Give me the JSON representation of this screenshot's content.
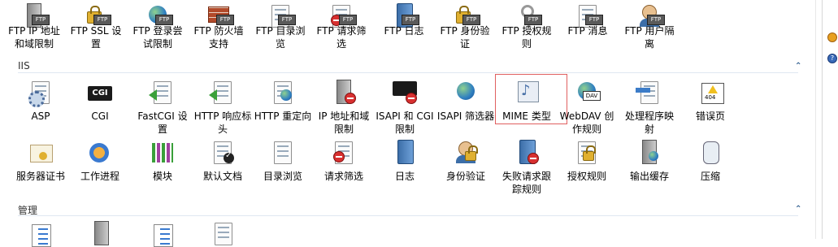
{
  "ftp_row": [
    "FTP IP 地址\n和域限制",
    "FTP SSL 设\n置",
    "FTP 登录尝\n试限制",
    "FTP 防火墙\n支持",
    "FTP 目录浏\n览",
    "FTP 请求筛\n选",
    "FTP 日志",
    "FTP 身份验\n证",
    "FTP 授权规\n则",
    "FTP 消息",
    "FTP 用户隔\n离"
  ],
  "iis": {
    "title": "IIS",
    "row1": [
      "ASP",
      "CGI",
      "FastCGI 设\n置",
      "HTTP 响应标\n头",
      "HTTP 重定向",
      "IP 地址和域\n限制",
      "ISAPI 和 CGI\n限制",
      "ISAPI 筛选器",
      "MIME 类型",
      "WebDAV 创\n作规则",
      "处理程序映\n射",
      "错误页"
    ],
    "row2": [
      "服务器证书",
      "工作进程",
      "模块",
      "默认文档",
      "目录浏览",
      "请求筛选",
      "日志",
      "身份验证",
      "失败请求跟\n踪规则",
      "授权规则",
      "输出缓存",
      "压缩"
    ]
  },
  "manage": {
    "title": "管理"
  },
  "icons": {
    "ftp_badge": "FTP",
    "cgi_badge": "CGI",
    "dav_badge": "DAV"
  },
  "colors": {
    "selection_border": "#e06060",
    "group_line": "#dfe8f1",
    "chevron": "#2a5a8c"
  },
  "selected_item": "MIME 类型"
}
